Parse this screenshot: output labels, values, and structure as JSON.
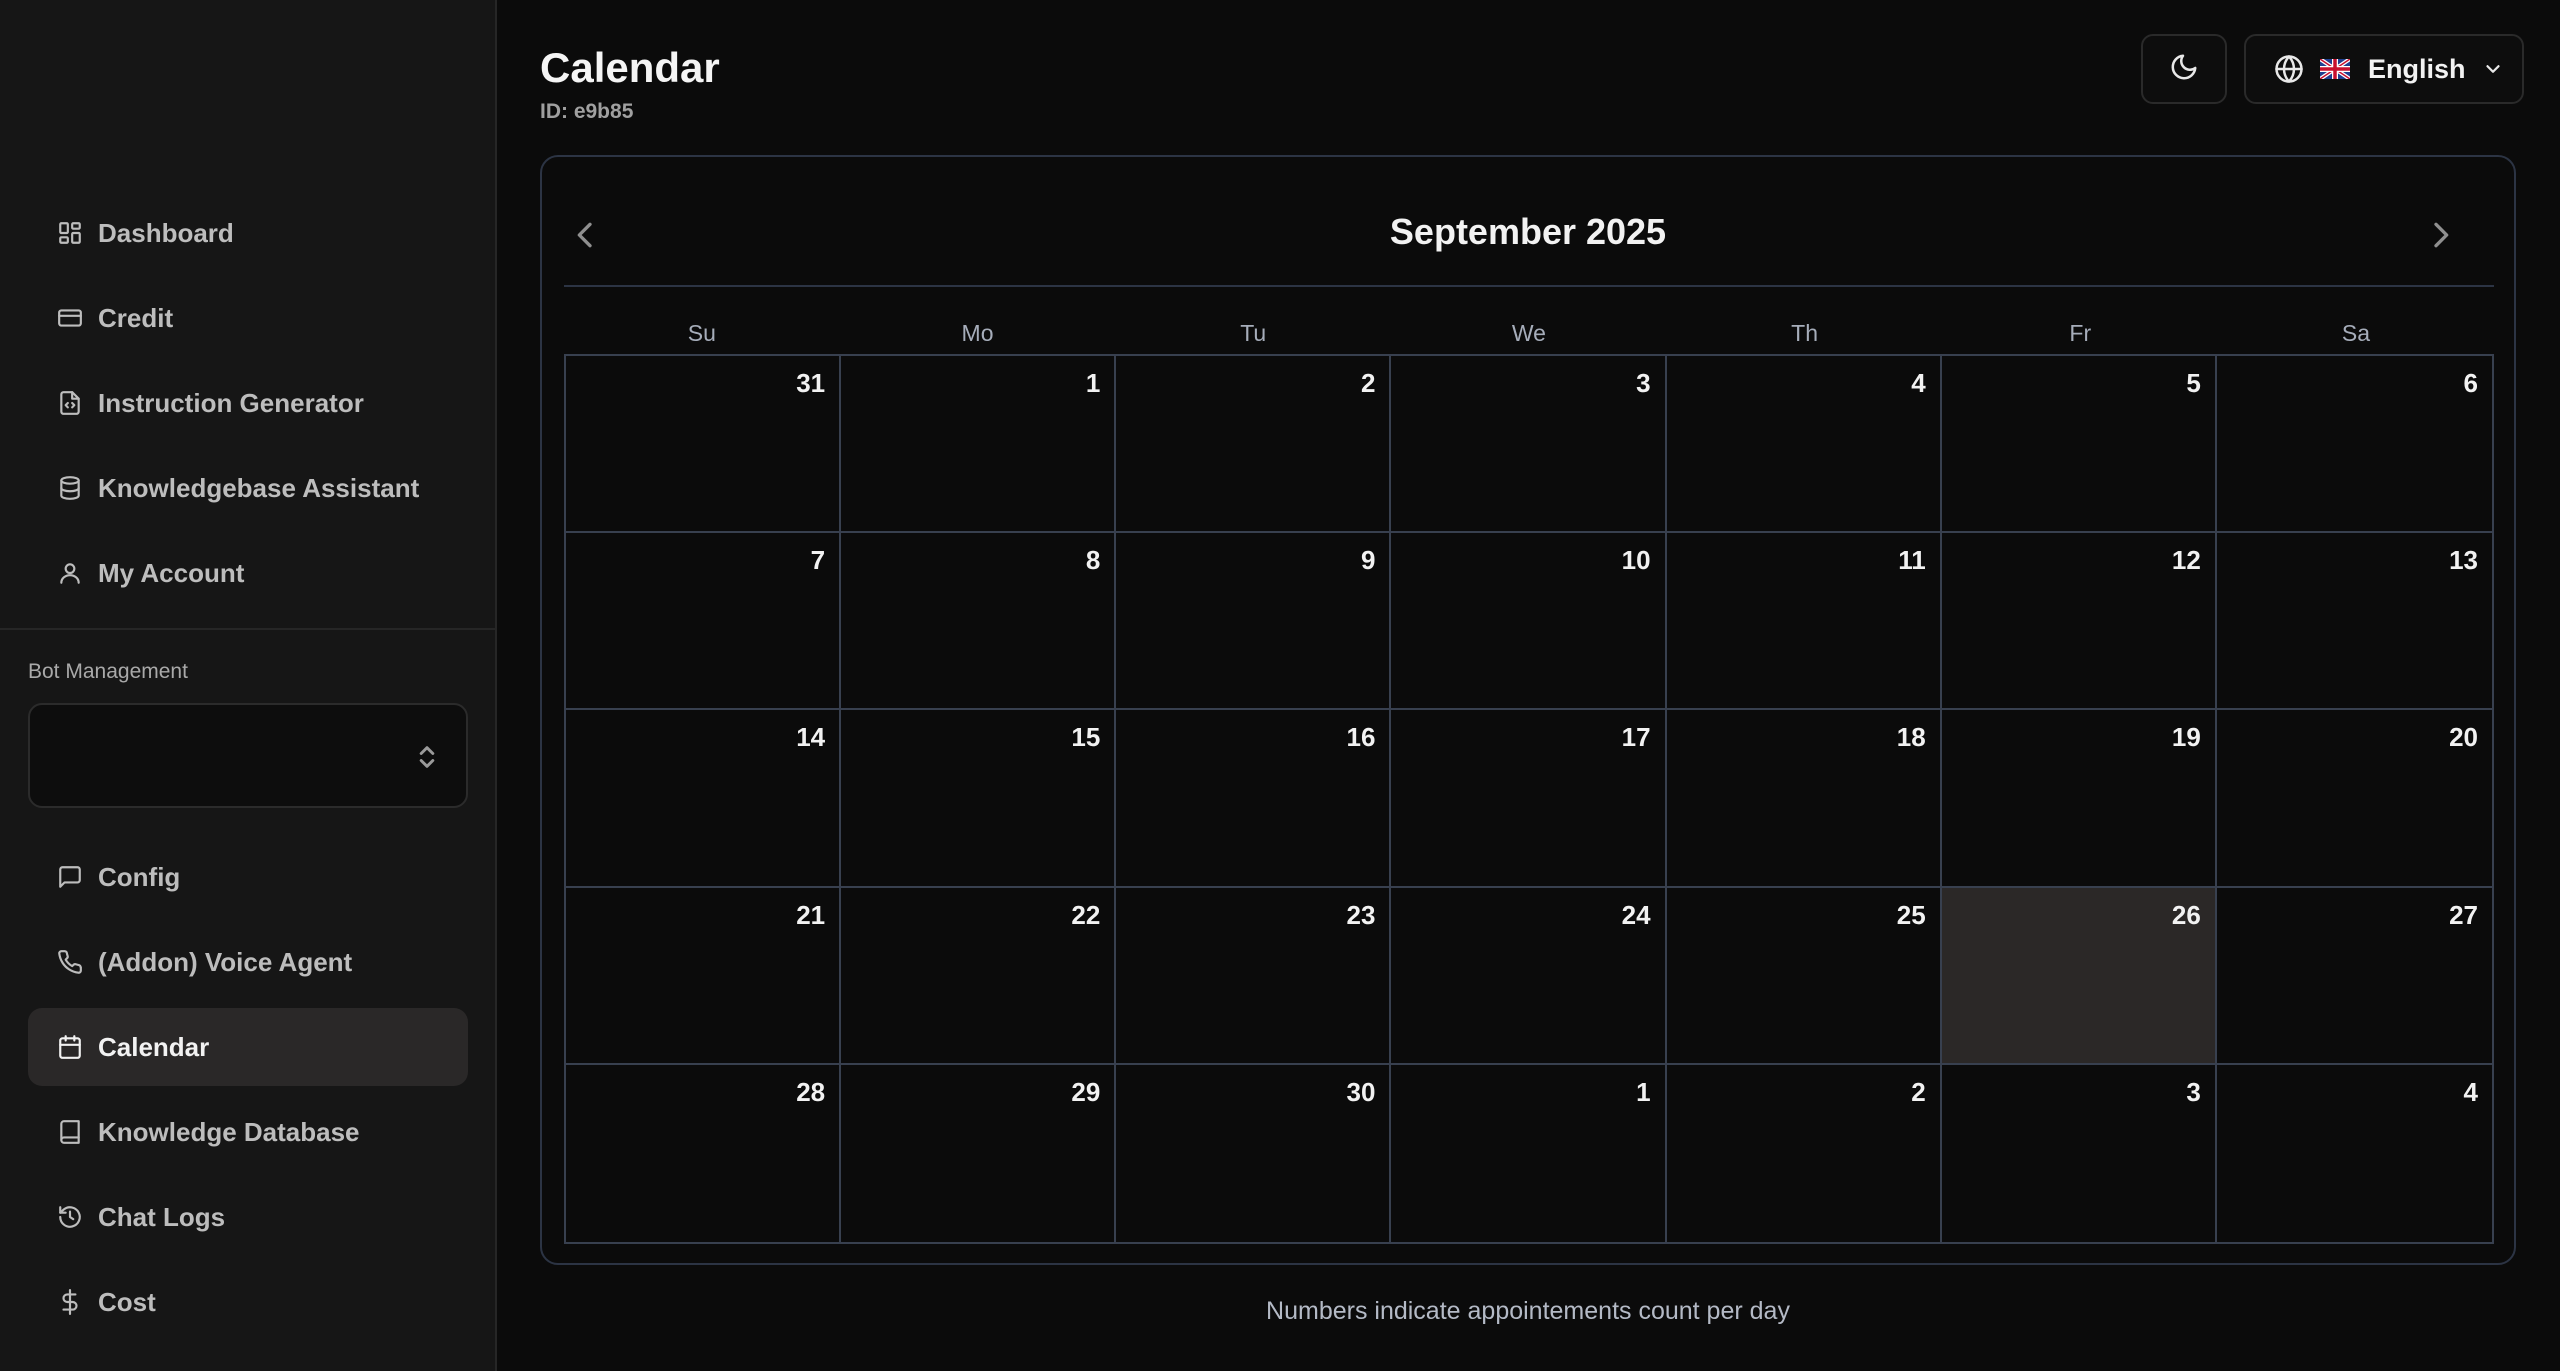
{
  "sidebar": {
    "items": [
      {
        "label": "Dashboard",
        "icon": "dashboard-icon"
      },
      {
        "label": "Credit",
        "icon": "credit-card-icon"
      },
      {
        "label": "Instruction Generator",
        "icon": "file-code-icon"
      },
      {
        "label": "Knowledgebase Assistant",
        "icon": "database-icon"
      },
      {
        "label": "My Account",
        "icon": "user-icon"
      }
    ],
    "section_label": "Bot Management",
    "bot_select_value": "",
    "bot_items": [
      {
        "label": "Config",
        "icon": "message-square-icon"
      },
      {
        "label": "(Addon) Voice Agent",
        "icon": "phone-icon"
      },
      {
        "label": "Calendar",
        "icon": "calendar-icon",
        "active": true
      },
      {
        "label": "Knowledge Database",
        "icon": "book-icon"
      },
      {
        "label": "Chat Logs",
        "icon": "history-icon"
      },
      {
        "label": "Cost",
        "icon": "dollar-icon"
      }
    ]
  },
  "header": {
    "title": "Calendar",
    "id_text": "ID: e9b85",
    "theme_icon": "moon-icon",
    "language": {
      "label": "English",
      "flag": "uk-flag-icon"
    }
  },
  "calendar": {
    "month_label": "September 2025",
    "weekdays": [
      "Su",
      "Mo",
      "Tu",
      "We",
      "Th",
      "Fr",
      "Sa"
    ],
    "days": [
      "31",
      "1",
      "2",
      "3",
      "4",
      "5",
      "6",
      "7",
      "8",
      "9",
      "10",
      "11",
      "12",
      "13",
      "14",
      "15",
      "16",
      "17",
      "18",
      "19",
      "20",
      "21",
      "22",
      "23",
      "24",
      "25",
      "26",
      "27",
      "28",
      "29",
      "30",
      "1",
      "2",
      "3",
      "4"
    ],
    "today": "26"
  },
  "footer_note": "Numbers indicate appointements count per day",
  "colors": {
    "background": "#0b0b0b",
    "sidebar": "#161616",
    "active_item": "#2a2828",
    "grid_border": "#38404f",
    "today_cell": "#2b2827"
  }
}
